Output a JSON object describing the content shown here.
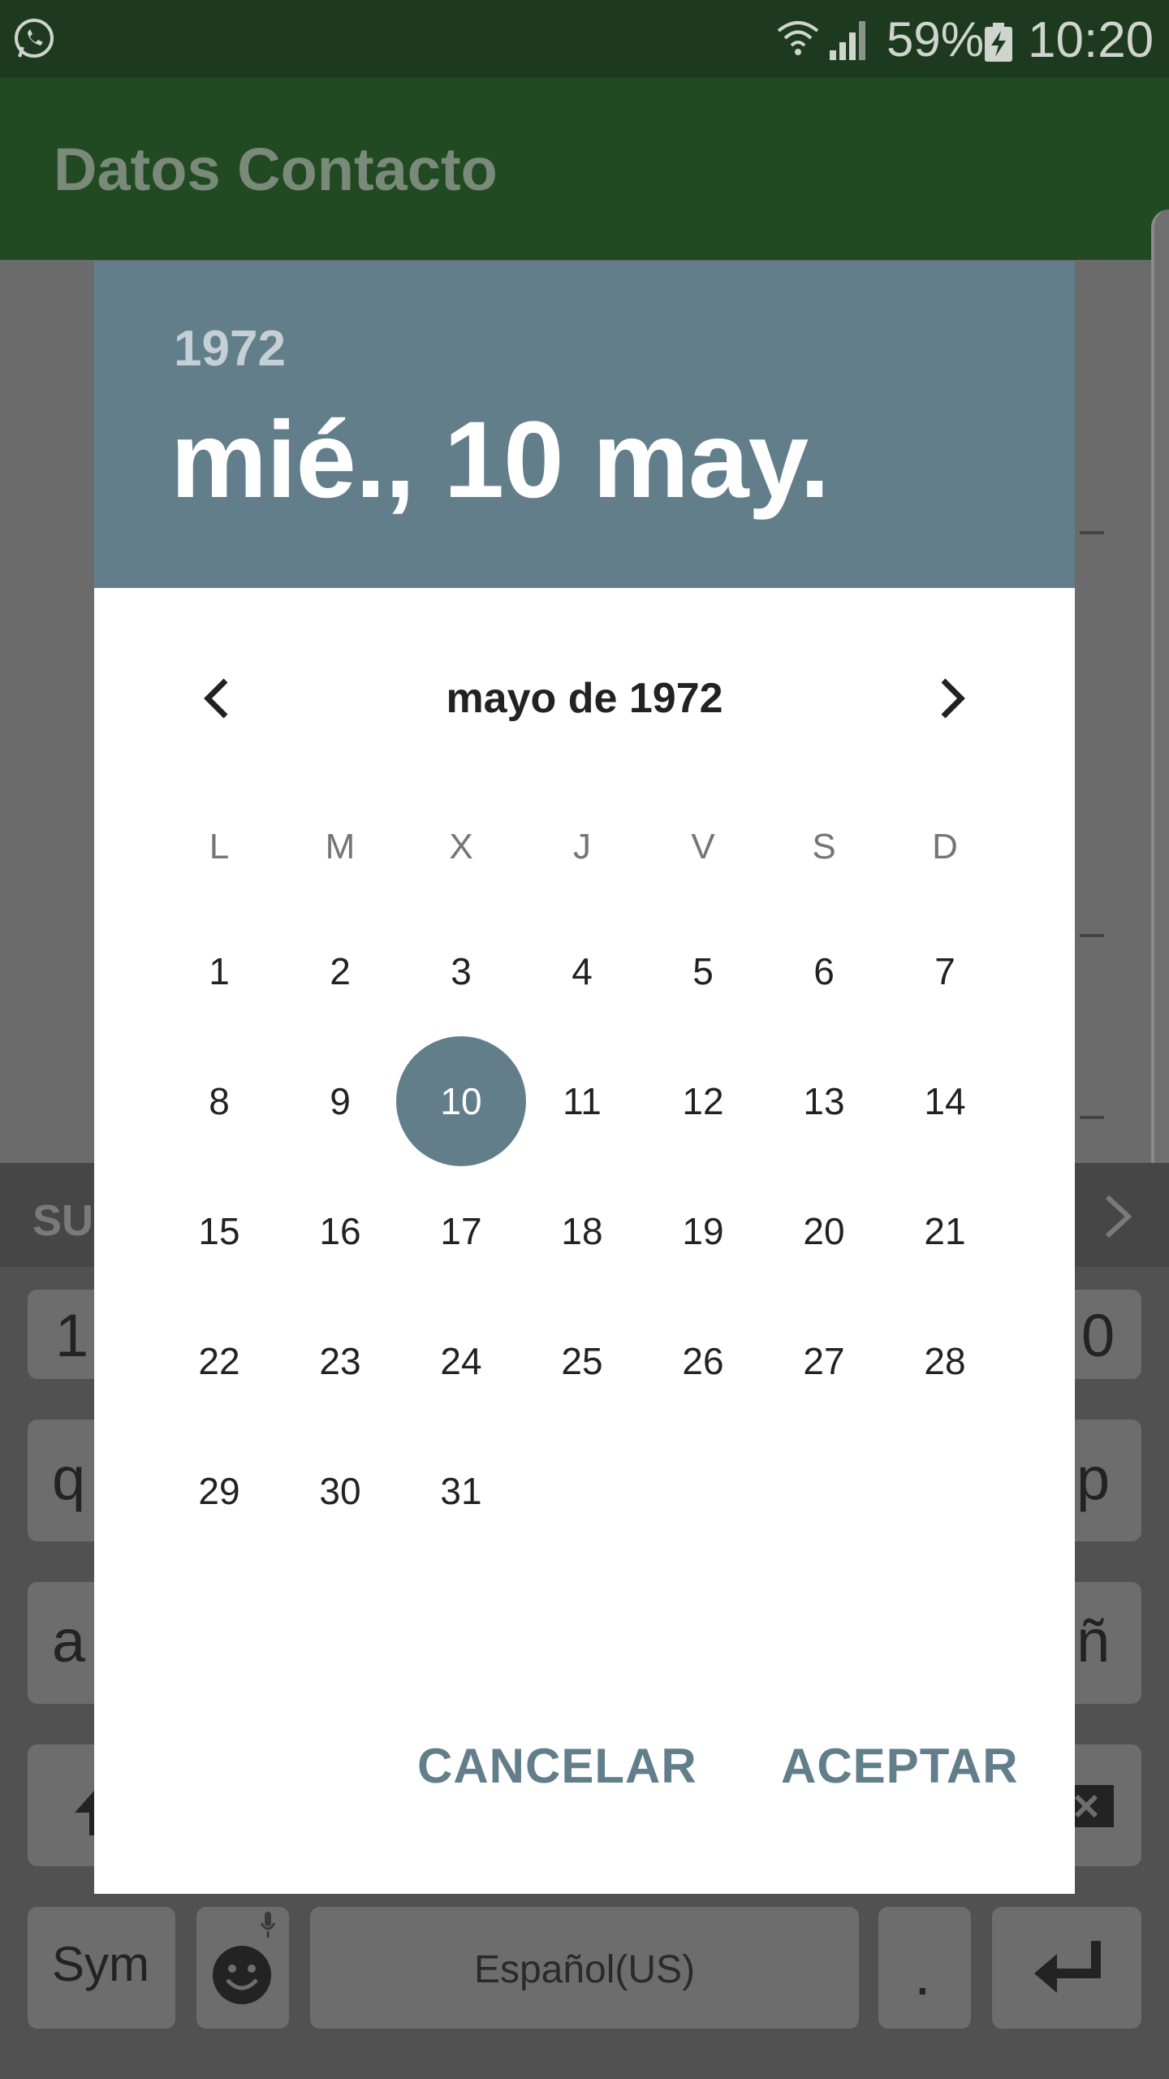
{
  "status_bar": {
    "battery_percent": "59%",
    "time": "10:20",
    "icons": [
      "whatsapp-icon",
      "wifi-icon",
      "signal-icon",
      "battery-charging-icon"
    ]
  },
  "app_bar": {
    "title": "Datos Contacto"
  },
  "keyboard": {
    "suggestion_prefix": "SU",
    "row1_left": "1",
    "row1_right": "0",
    "row2_left": "q",
    "row2_right": "p",
    "row3_left": "a",
    "row3_right": "ñ",
    "sym": "Sym",
    "space": "Español(US)",
    "period": "."
  },
  "dialog": {
    "year": "1972",
    "date": "mié., 10 may.",
    "month_title": "mayo de 1972",
    "weekdays": [
      "L",
      "M",
      "X",
      "J",
      "V",
      "S",
      "D"
    ],
    "days": [
      "1",
      "2",
      "3",
      "4",
      "5",
      "6",
      "7",
      "8",
      "9",
      "10",
      "11",
      "12",
      "13",
      "14",
      "15",
      "16",
      "17",
      "18",
      "19",
      "20",
      "21",
      "22",
      "23",
      "24",
      "25",
      "26",
      "27",
      "28",
      "29",
      "30",
      "31"
    ],
    "selected_day": "10",
    "first_weekday_index": 0,
    "cancel_label": "CANCELAR",
    "accept_label": "ACEPTAR",
    "accent_color": "#637e8b"
  }
}
